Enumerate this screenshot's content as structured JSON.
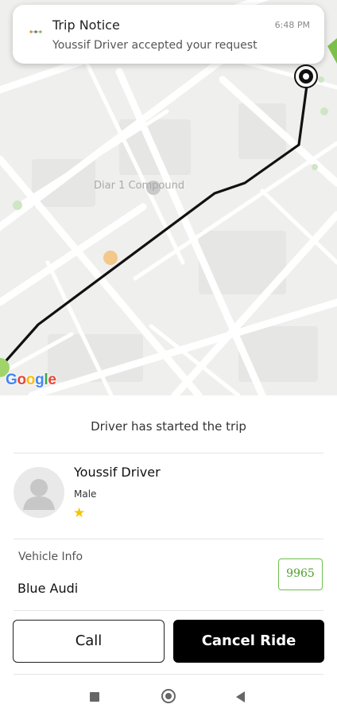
{
  "notification": {
    "title": "Trip Notice",
    "message": "Youssif Driver accepted your request",
    "time": "6:48 PM",
    "icon": "car-icon"
  },
  "map": {
    "place_labels": [
      "Diar 1 Compound"
    ],
    "attribution": "Google",
    "route_color": "#111111"
  },
  "trip": {
    "status": "Driver has started the trip"
  },
  "driver": {
    "name": "Youssif Driver",
    "gender": "Male",
    "rating_icon": "star-icon",
    "avatar_icon": "person-placeholder-icon"
  },
  "vehicle": {
    "label": "Vehicle Info",
    "name": "Blue Audi",
    "plate": "9965",
    "plate_color": "#4e9d2b"
  },
  "actions": {
    "call_label": "Call",
    "cancel_label": "Cancel Ride"
  },
  "navbar": {
    "icons": [
      "recents-icon",
      "home-icon",
      "back-icon"
    ]
  }
}
